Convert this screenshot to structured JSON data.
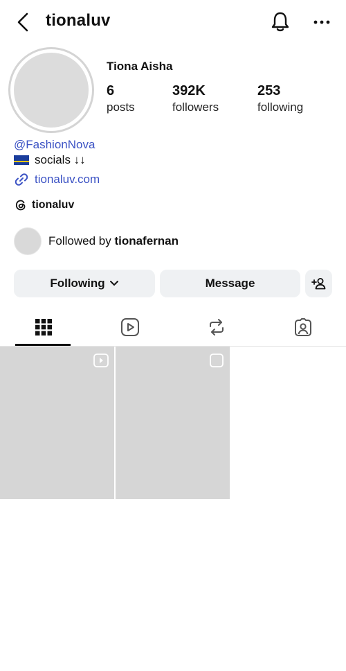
{
  "header": {
    "username": "tionaluv"
  },
  "profile": {
    "full_name": "Tiona Aisha",
    "stats": [
      {
        "value": "6",
        "label": "posts"
      },
      {
        "value": "392K",
        "label": "followers"
      },
      {
        "value": "253",
        "label": "following"
      }
    ],
    "bio": {
      "mention": "@FashionNova",
      "line": "socials ↓↓",
      "link": "tionaluv.com",
      "threads": "tionaluv"
    },
    "followed_by": {
      "prefix": "Followed by",
      "name": "tionafernan"
    }
  },
  "actions": {
    "following_label": "Following",
    "message_label": "Message"
  },
  "tabs": [
    {
      "icon": "grid-icon",
      "active": true
    },
    {
      "icon": "reels-icon",
      "active": false
    },
    {
      "icon": "reposts-icon",
      "active": false
    },
    {
      "icon": "tagged-icon",
      "active": false
    }
  ],
  "posts": [
    {
      "type": "reel",
      "badge": "play-icon"
    },
    {
      "type": "post",
      "badge": "square-icon"
    }
  ],
  "colors": {
    "link": "#3b52c4",
    "button_bg": "#eff1f3",
    "text": "#111111"
  }
}
